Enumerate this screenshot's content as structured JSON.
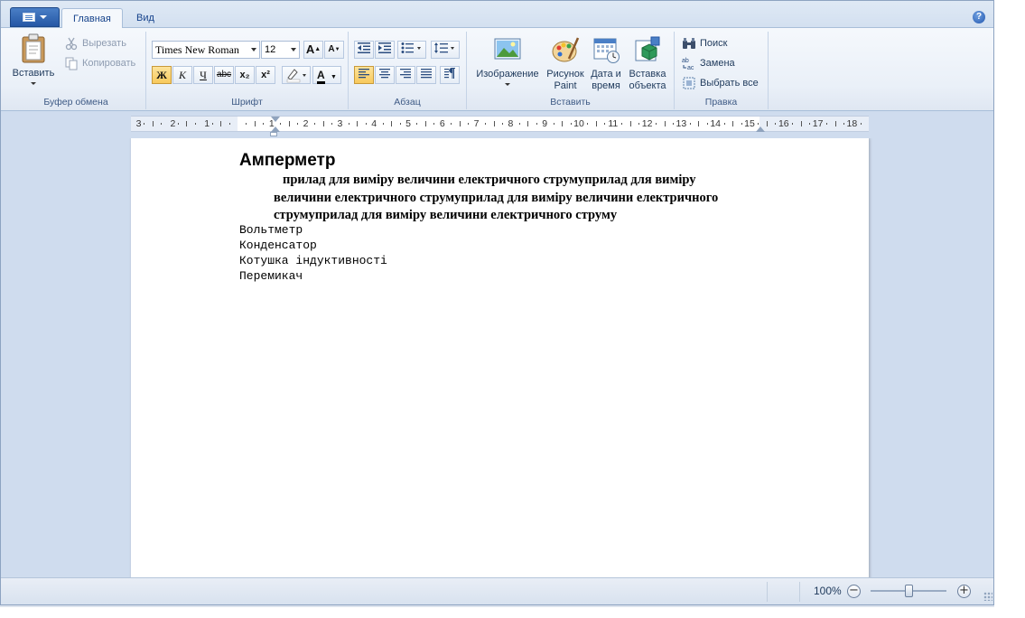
{
  "tabs": [
    {
      "label": "Главная",
      "active": true
    },
    {
      "label": "Вид",
      "active": false
    }
  ],
  "help_icon": "help-icon",
  "clipboard": {
    "paste_label": "Вставить",
    "cut_label": "Вырезать",
    "copy_label": "Копировать",
    "group_label": "Буфер обмена"
  },
  "font": {
    "family_value": "Times New Roman",
    "size_value": "12",
    "grow_label": "A",
    "shrink_label": "A",
    "bold_label": "Ж",
    "italic_label": "К",
    "underline_label": "Ч",
    "strike_label": "abc",
    "subscript_label": "x₂",
    "superscript_label": "x²",
    "color_label": "A",
    "group_label": "Шрифт"
  },
  "paragraph": {
    "group_label": "Абзац"
  },
  "insert": {
    "image_label": "Изображение",
    "paint_label_1": "Рисунок",
    "paint_label_2": "Paint",
    "datetime_label_1": "Дата и",
    "datetime_label_2": "время",
    "object_label_1": "Вставка",
    "object_label_2": "объекта",
    "group_label": "Вставить"
  },
  "editing": {
    "find_label": "Поиск",
    "replace_label": "Замена",
    "select_all_label": "Выбрать все",
    "group_label": "Правка"
  },
  "ruler": {
    "left_numbers": [
      "3",
      "2",
      "1"
    ],
    "right_numbers": [
      "1",
      "2",
      "3",
      "4",
      "5",
      "6",
      "7",
      "8",
      "9",
      "10",
      "11",
      "12",
      "13",
      "14",
      "15",
      "16",
      "17",
      "18"
    ]
  },
  "document": {
    "title": "Амперметр",
    "bold_paragraph": "прилад для виміру величини електричного струмуприлад для виміру величини електричного струмуприлад для виміру величини електричного струмуприлад для виміру величини електричного струму",
    "lines": [
      "Вольтметр",
      "Конденсатор",
      "Котушка індуктивності",
      "Перемикач"
    ]
  },
  "status": {
    "zoom_label": "100%",
    "zoom_percent": 100,
    "zoom_out": "−",
    "zoom_in": "+"
  },
  "colors": {
    "accent": "#2557a5",
    "ribbon_bg": "#eaf0f8",
    "window_bg": "#cfdcee",
    "highlight": "#f8c95c"
  }
}
